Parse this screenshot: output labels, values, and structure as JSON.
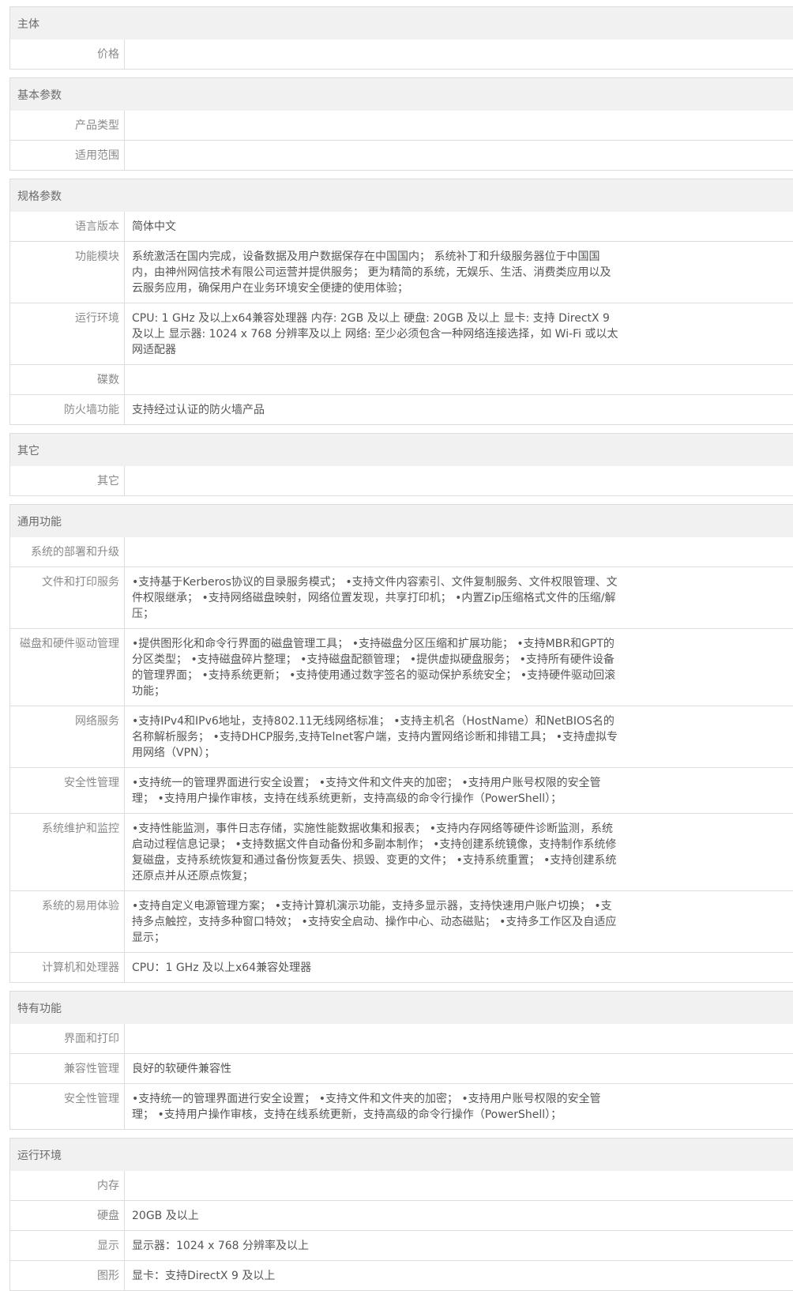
{
  "sections": [
    {
      "title": "主体",
      "rows": [
        {
          "label": "价格",
          "value": ""
        }
      ]
    },
    {
      "title": "基本参数",
      "rows": [
        {
          "label": "产品类型",
          "value": ""
        },
        {
          "label": "适用范围",
          "value": ""
        }
      ]
    },
    {
      "title": "规格参数",
      "rows": [
        {
          "label": "语言版本",
          "value": "简体中文"
        },
        {
          "label": "功能模块",
          "value": "系统激活在国内完成，设备数据及用户数据保存在中国国内； 系统补丁和升级服务器位于中国国内，由神州网信技术有限公司运营并提供服务； 更为精简的系统，无娱乐、生活、消费类应用以及云服务应用，确保用户在业务环境安全便捷的使用体验；"
        },
        {
          "label": "运行环境",
          "value": "CPU: 1 GHz 及以上x64兼容处理器 内存: 2GB 及以上 硬盘: 20GB 及以上 显卡: 支持 DirectX 9 及以上 显示器: 1024 x 768 分辨率及以上 网络: 至少必须包含一种网络连接选择，如 Wi-Fi 或以太网适配器"
        },
        {
          "label": "碟数",
          "value": ""
        },
        {
          "label": "防火墙功能",
          "value": "支持经过认证的防火墙产品"
        }
      ]
    },
    {
      "title": "其它",
      "rows": [
        {
          "label": "其它",
          "value": ""
        }
      ]
    },
    {
      "title": "通用功能",
      "rows": [
        {
          "label": "系统的部署和升级",
          "value": ""
        },
        {
          "label": "文件和打印服务",
          "value": "•支持基于Kerberos协议的目录服务模式； •支持文件内容索引、文件复制服务、文件权限管理、文件权限继承； •支持网络磁盘映射，网络位置发现，共享打印机； •内置Zip压缩格式文件的压缩/解压；"
        },
        {
          "label": "磁盘和硬件驱动管理",
          "value": "•提供图形化和命令行界面的磁盘管理工具； •支持磁盘分区压缩和扩展功能； •支持MBR和GPT的分区类型； •支持磁盘碎片整理； •支持磁盘配额管理； •提供虚拟硬盘服务； •支持所有硬件设备的管理界面； •支持系统更新； •支持使用通过数字签名的驱动保护系统安全； •支持硬件驱动回滚功能；"
        },
        {
          "label": "网络服务",
          "value": "•支持IPv4和IPv6地址，支持802.11无线网络标准； •支持主机名（HostName）和NetBIOS名的名称解析服务； •支持DHCP服务,支持Telnet客户端，支持内置网络诊断和排错工具； •支持虚拟专用网络（VPN）；"
        },
        {
          "label": "安全性管理",
          "value": "•支持统一的管理界面进行安全设置； •支持文件和文件夹的加密； •支持用户账号权限的安全管理； •支持用户操作审核，支持在线系统更新，支持高级的命令行操作（PowerShell）；"
        },
        {
          "label": "系统维护和监控",
          "value": "•支持性能监测，事件日志存储，实施性能数据收集和报表； •支持内存网络等硬件诊断监测，系统启动过程信息记录； •支持数据文件自动备份和多副本制作； •支持创建系统镜像，支持制作系统修复磁盘，支持系统恢复和通过备份恢复丢失、损毁、变更的文件； •支持系统重置； •支持创建系统还原点并从还原点恢复；"
        },
        {
          "label": "系统的易用体验",
          "value": "•支持自定义电源管理方案； •支持计算机演示功能，支持多显示器，支持快速用户账户切换； •支持多点触控，支持多种窗口特效； •支持安全启动、操作中心、动态磁贴； •支持多工作区及自适应显示；"
        },
        {
          "label": "计算机和处理器",
          "value": "CPU：1 GHz 及以上x64兼容处理器"
        }
      ]
    },
    {
      "title": "特有功能",
      "rows": [
        {
          "label": "界面和打印",
          "value": ""
        },
        {
          "label": "兼容性管理",
          "value": "良好的软硬件兼容性"
        },
        {
          "label": "安全性管理",
          "value": "•支持统一的管理界面进行安全设置； •支持文件和文件夹的加密； •支持用户账号权限的安全管理； •支持用户操作审核，支持在线系统更新，支持高级的命令行操作（PowerShell）；"
        }
      ]
    },
    {
      "title": "运行环境",
      "rows": [
        {
          "label": "内存",
          "value": ""
        },
        {
          "label": "硬盘",
          "value": "20GB 及以上"
        },
        {
          "label": "显示",
          "value": "显示器：1024 x 768 分辨率及以上"
        },
        {
          "label": "图形",
          "value": "显卡：支持DirectX 9 及以上"
        }
      ]
    }
  ]
}
